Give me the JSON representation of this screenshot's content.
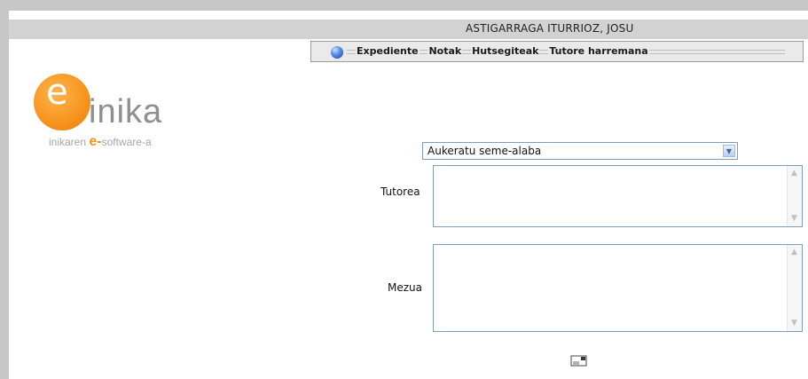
{
  "header": {
    "user_name": "ASTIGARRAGA ITURRIOZ, JOSU"
  },
  "menu": {
    "items": [
      {
        "label": "Expediente"
      },
      {
        "label": "Notak"
      },
      {
        "label": "Hutsegiteak"
      },
      {
        "label": "Tutore harremana"
      }
    ]
  },
  "logo": {
    "letter": "e",
    "word": "inika",
    "tag_prefix": "inikaren ",
    "tag_letter": "e-",
    "tag_suffix": "software-a"
  },
  "form": {
    "child_select": {
      "selected": "Aukeratu seme-alaba"
    },
    "tutor": {
      "label": "Tutorea",
      "value": ""
    },
    "message": {
      "label": "Mezua",
      "value": ""
    }
  },
  "colors": {
    "bar_gray": "#c7c7c7",
    "logo_orange": "#f7931e",
    "field_border": "#7f9db9"
  },
  "icons": {
    "menu": "globe-icon",
    "send": "send-message-icon"
  }
}
